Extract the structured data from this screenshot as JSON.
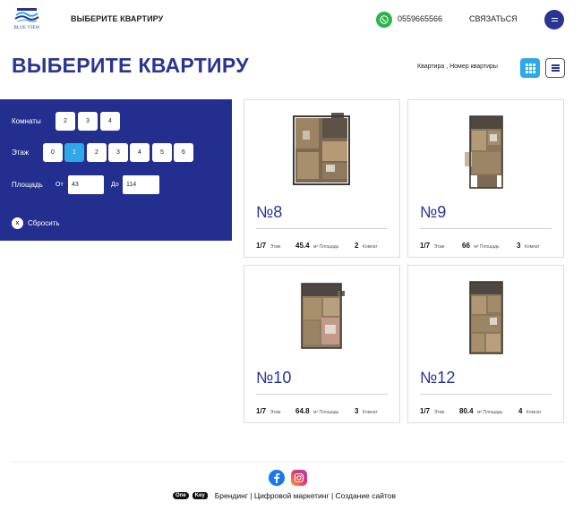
{
  "header": {
    "logo_text": "BLUE VIEW",
    "nav_title": "ВЫБЕРИТЕ КВАРТИРУ",
    "phone": "0559665566",
    "contact_label": "СВЯЗАТЬСЯ"
  },
  "page": {
    "title": "ВЫБЕРИТЕ КВАРТИРУ",
    "sort_label": "Квартира , Номер квартиры"
  },
  "filters": {
    "rooms_label": "Комнаты",
    "rooms_options": [
      "2",
      "3",
      "4"
    ],
    "floor_label": "Этаж",
    "floor_options": [
      "0",
      "1",
      "2",
      "3",
      "4",
      "5",
      "6"
    ],
    "floor_selected": "1",
    "area_label": "Площадь",
    "area_from_label": "От",
    "area_from_value": "43",
    "area_to_label": "До",
    "area_to_value": "114",
    "reset_icon": "x",
    "reset_label": "Сбросить"
  },
  "apartments": [
    {
      "number": "№8",
      "floor": "1/7",
      "floor_unit": "Этаж",
      "area": "45.4",
      "area_unit": "м² Площадь",
      "rooms": "2",
      "rooms_unit": "Комнат"
    },
    {
      "number": "№9",
      "floor": "1/7",
      "floor_unit": "Этаж",
      "area": "66",
      "area_unit": "м² Площадь",
      "rooms": "3",
      "rooms_unit": "Комнат"
    },
    {
      "number": "№10",
      "floor": "1/7",
      "floor_unit": "Этаж",
      "area": "64.8",
      "area_unit": "м² Площадь",
      "rooms": "3",
      "rooms_unit": "Комнат"
    },
    {
      "number": "№12",
      "floor": "1/7",
      "floor_unit": "Этаж",
      "area": "80.4",
      "area_unit": "м² Площадь",
      "rooms": "4",
      "rooms_unit": "Комнат"
    }
  ],
  "footer": {
    "badge_one": "One",
    "badge_key": "Key",
    "credits": "Брендинг | Цифровой маркетинг | Создание сайтов"
  },
  "colors": {
    "brand_blue": "#232f8e",
    "accent_cyan": "#2ea8e6",
    "whatsapp_green": "#29b34a"
  }
}
